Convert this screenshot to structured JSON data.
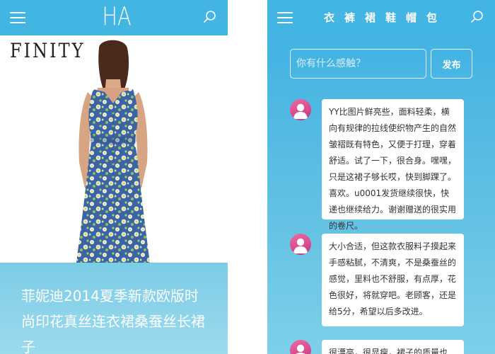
{
  "left_screen": {
    "header": {
      "logo_text": "HA",
      "menu_icon": "hamburger-menu-icon",
      "search_icon": "search-icon"
    },
    "product": {
      "brand_text": "FINITY",
      "title": "菲妮迪2014夏季新款欧版时尚印花真丝连衣裙桑蚕丝长裙子"
    }
  },
  "right_screen": {
    "header": {
      "menu_icon": "hamburger-menu-icon",
      "search_icon": "search-icon",
      "categories": [
        "衣",
        "裤",
        "裙",
        "鞋",
        "帽",
        "包"
      ]
    },
    "composer": {
      "placeholder": "你有什么感触？",
      "submit_label": "发布"
    },
    "comments": [
      {
        "text": "YY比图片鲜亮些，面料轻柔，横向有规律的拉线使织物产生的自然皱褶既有特色，又便于打理，穿着舒适。试了一下，很合身。嘿嘿，只是这裙子够长哎，快到脚踝了。喜欢。u0001发货继续很快，快递也继续给力。谢谢赠送的很实用的卷尺。"
      },
      {
        "text": "大小合适，但这款衣服料子摸起来手感粘腻，不清爽，不是桑蚕丝的感觉，里料也不舒服，有点厚，花色很好，将就穿吧。老顾客，还是给5分，希望以后多改进。"
      },
      {
        "text": "很漂亮，很显瘦，裙子的质量也"
      }
    ]
  },
  "colors": {
    "header_blue": "#43b5e3",
    "caption_gradient_top": "#7ccce6",
    "caption_gradient_bottom": "#9cdaee",
    "panel_gradient_top": "#3bb0e3",
    "panel_gradient_bottom": "#7ed0e8",
    "avatar_pink": "#e0508f"
  }
}
